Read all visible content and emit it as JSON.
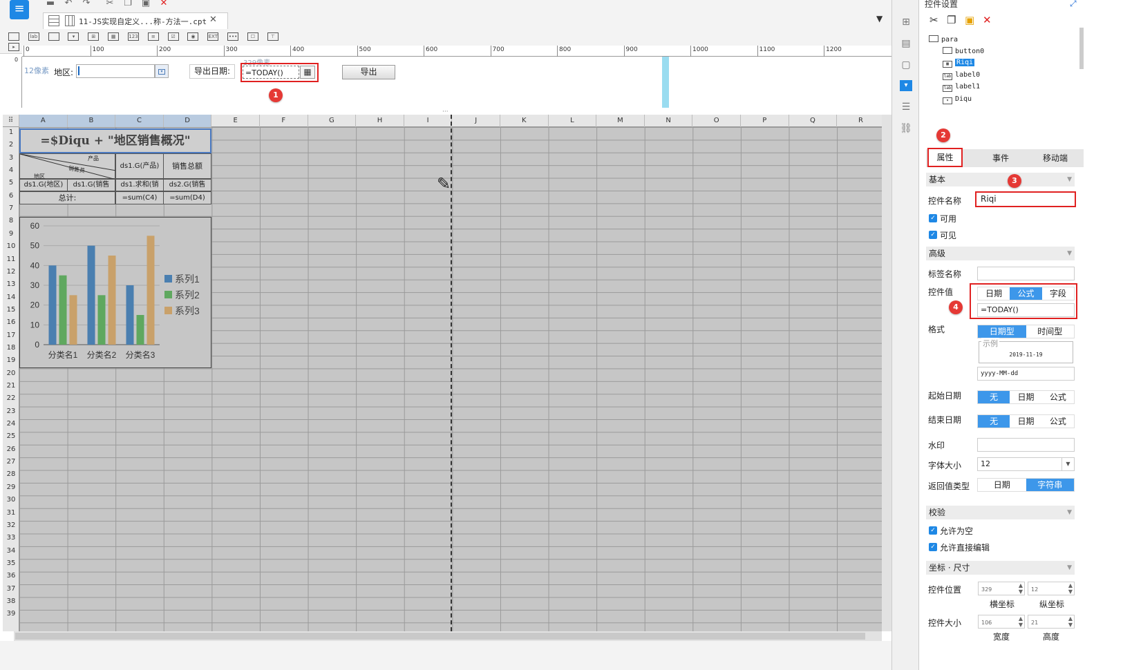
{
  "tab": {
    "title": "11-JS实现自定义...称-方法一.cpt"
  },
  "ruler": {
    "ticks": [
      "0",
      "100",
      "200",
      "300",
      "400",
      "500",
      "600",
      "700",
      "800",
      "900",
      "1000",
      "1100",
      "1200"
    ],
    "side": "0"
  },
  "params": {
    "px_left": "12像素",
    "diqu_label": "地区:",
    "date_label": "导出日期:",
    "px_top": "329像素",
    "riqi_value": "=TODAY()",
    "export_button": "导出",
    "badge1": "1"
  },
  "sheet": {
    "columns": [
      "A",
      "B",
      "C",
      "D",
      "E",
      "F",
      "G",
      "H",
      "I",
      "J",
      "K",
      "L",
      "M",
      "N",
      "O",
      "P",
      "Q",
      "R"
    ],
    "rows": [
      "1",
      "2",
      "3",
      "4",
      "5",
      "6",
      "7",
      "8",
      "9",
      "10",
      "11",
      "12",
      "13",
      "14",
      "15",
      "16",
      "17",
      "18",
      "19",
      "20",
      "21",
      "22",
      "23",
      "24",
      "25",
      "26",
      "27",
      "28",
      "29",
      "30",
      "31",
      "32",
      "33",
      "34",
      "35",
      "36",
      "37",
      "38",
      "39"
    ],
    "title": "=$Diqu + \"地区销售概况\"",
    "diag_top": "产品",
    "diag_mid": "销售员",
    "diag_bottom": "地区",
    "c3": "ds1.G(产品)",
    "d3": "销售总额",
    "a4": "ds1.G(地区)",
    "b4": "ds1.G(销售",
    "c4": "ds1.求和(销",
    "d4": "ds2.G(销售",
    "a5": "总计:",
    "c5": "=sum(C4)",
    "d5": "=sum(D4)"
  },
  "chart_data": {
    "type": "bar",
    "categories": [
      "分类名1",
      "分类名2",
      "分类名3"
    ],
    "series": [
      {
        "name": "系列1",
        "values": [
          40,
          50,
          30
        ],
        "color": "#4a7fb0"
      },
      {
        "name": "系列2",
        "values": [
          35,
          25,
          15
        ],
        "color": "#5fa85f"
      },
      {
        "name": "系列3",
        "values": [
          25,
          45,
          55
        ],
        "color": "#c9a16a"
      }
    ],
    "yticks": [
      "0",
      "10",
      "20",
      "30",
      "40",
      "50",
      "60"
    ],
    "ylim": [
      0,
      60
    ],
    "legend": "right",
    "grid": true
  },
  "panel": {
    "title": "控件设置",
    "tree": {
      "root": "para",
      "items": [
        "button0",
        "Riqi",
        "label0",
        "label1",
        "Diqu"
      ]
    },
    "tabs": [
      "属性",
      "事件",
      "移动端"
    ],
    "badges": [
      "2",
      "3",
      "4"
    ],
    "basic": "基本",
    "name_label": "控件名称",
    "name_value": "Riqi",
    "enabled": "可用",
    "visible": "可见",
    "advanced": "高级",
    "tag_label": "标签名称",
    "value_label": "控件值",
    "value_opts": [
      "日期",
      "公式",
      "字段"
    ],
    "value_formula": "=TODAY()",
    "format_label": "格式",
    "format_opts": [
      "日期型",
      "时间型"
    ],
    "example_caption": "示例",
    "example_value": "2019-11-19",
    "pattern": "yyyy-MM-dd",
    "start_label": "起始日期",
    "end_label": "结束日期",
    "range_opts": [
      "无",
      "日期",
      "公式"
    ],
    "watermark_label": "水印",
    "fontsize_label": "字体大小",
    "fontsize_value": "12",
    "return_label": "返回值类型",
    "return_opts": [
      "日期",
      "字符串"
    ],
    "validate": "校验",
    "allow_empty": "允许为空",
    "allow_edit": "允许直接编辑",
    "coord_section": "坐标 · 尺寸",
    "pos_label": "控件位置",
    "pos_x": "329",
    "pos_y": "12",
    "x_caption": "横坐标",
    "y_caption": "纵坐标",
    "size_label": "控件大小",
    "width": "106",
    "height": "21",
    "w_caption": "宽度",
    "h_caption": "高度"
  }
}
